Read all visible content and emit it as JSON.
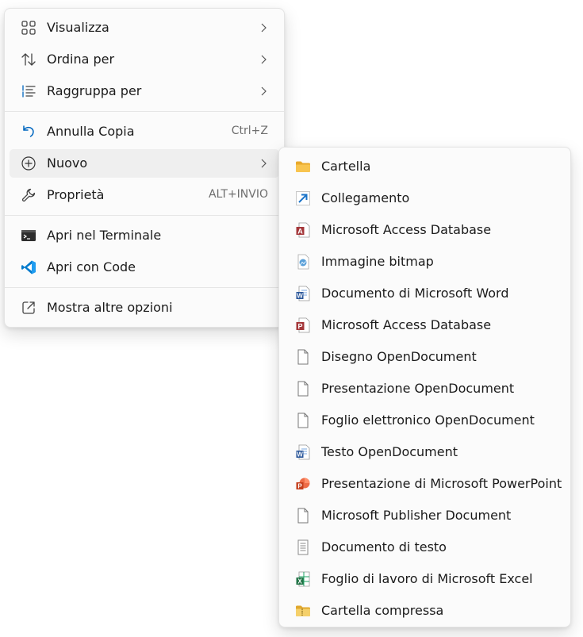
{
  "context_menu": {
    "items": [
      {
        "label": "Visualizza",
        "icon": "grid-view-icon"
      },
      {
        "label": "Ordina per",
        "icon": "sort-icon"
      },
      {
        "label": "Raggruppa per",
        "icon": "group-list-icon"
      },
      {
        "label": "Annulla Copia",
        "icon": "undo-icon",
        "shortcut": "Ctrl+Z"
      },
      {
        "label": "Nuovo",
        "icon": "add-circle-icon"
      },
      {
        "label": "Proprietà",
        "icon": "wrench-icon",
        "shortcut": "ALT+INVIO"
      },
      {
        "label": "Apri nel Terminale",
        "icon": "terminal-icon"
      },
      {
        "label": "Apri con Code",
        "icon": "vscode-icon"
      },
      {
        "label": "Mostra altre opzioni",
        "icon": "open-external-icon"
      }
    ]
  },
  "submenu_new": {
    "items": [
      {
        "label": "Cartella",
        "icon": "folder-icon"
      },
      {
        "label": "Collegamento",
        "icon": "shortcut-arrow-icon"
      },
      {
        "label": "Microsoft Access Database",
        "icon": "access-icon"
      },
      {
        "label": "Immagine bitmap",
        "icon": "bitmap-icon"
      },
      {
        "label": "Documento di Microsoft Word",
        "icon": "word-icon"
      },
      {
        "label": "Microsoft Access Database",
        "icon": "access-icon"
      },
      {
        "label": "Disegno OpenDocument",
        "icon": "blank-file-icon"
      },
      {
        "label": "Presentazione OpenDocument",
        "icon": "blank-file-icon"
      },
      {
        "label": "Foglio elettronico OpenDocument",
        "icon": "blank-file-icon"
      },
      {
        "label": "Testo OpenDocument",
        "icon": "word-icon"
      },
      {
        "label": "Presentazione di Microsoft PowerPoint",
        "icon": "powerpoint-icon"
      },
      {
        "label": "Microsoft Publisher Document",
        "icon": "blank-file-icon"
      },
      {
        "label": "Documento di testo",
        "icon": "text-file-icon"
      },
      {
        "label": "Foglio di lavoro di Microsoft Excel",
        "icon": "excel-icon"
      },
      {
        "label": "Cartella compressa",
        "icon": "zip-folder-icon"
      }
    ]
  },
  "colors": {
    "hover": "#efefef",
    "accent": "#0067c0",
    "word": "#2b579a",
    "excel": "#217346",
    "powerpoint": "#c43e1c",
    "access": "#a4373a",
    "folder": "#f8c44f"
  }
}
